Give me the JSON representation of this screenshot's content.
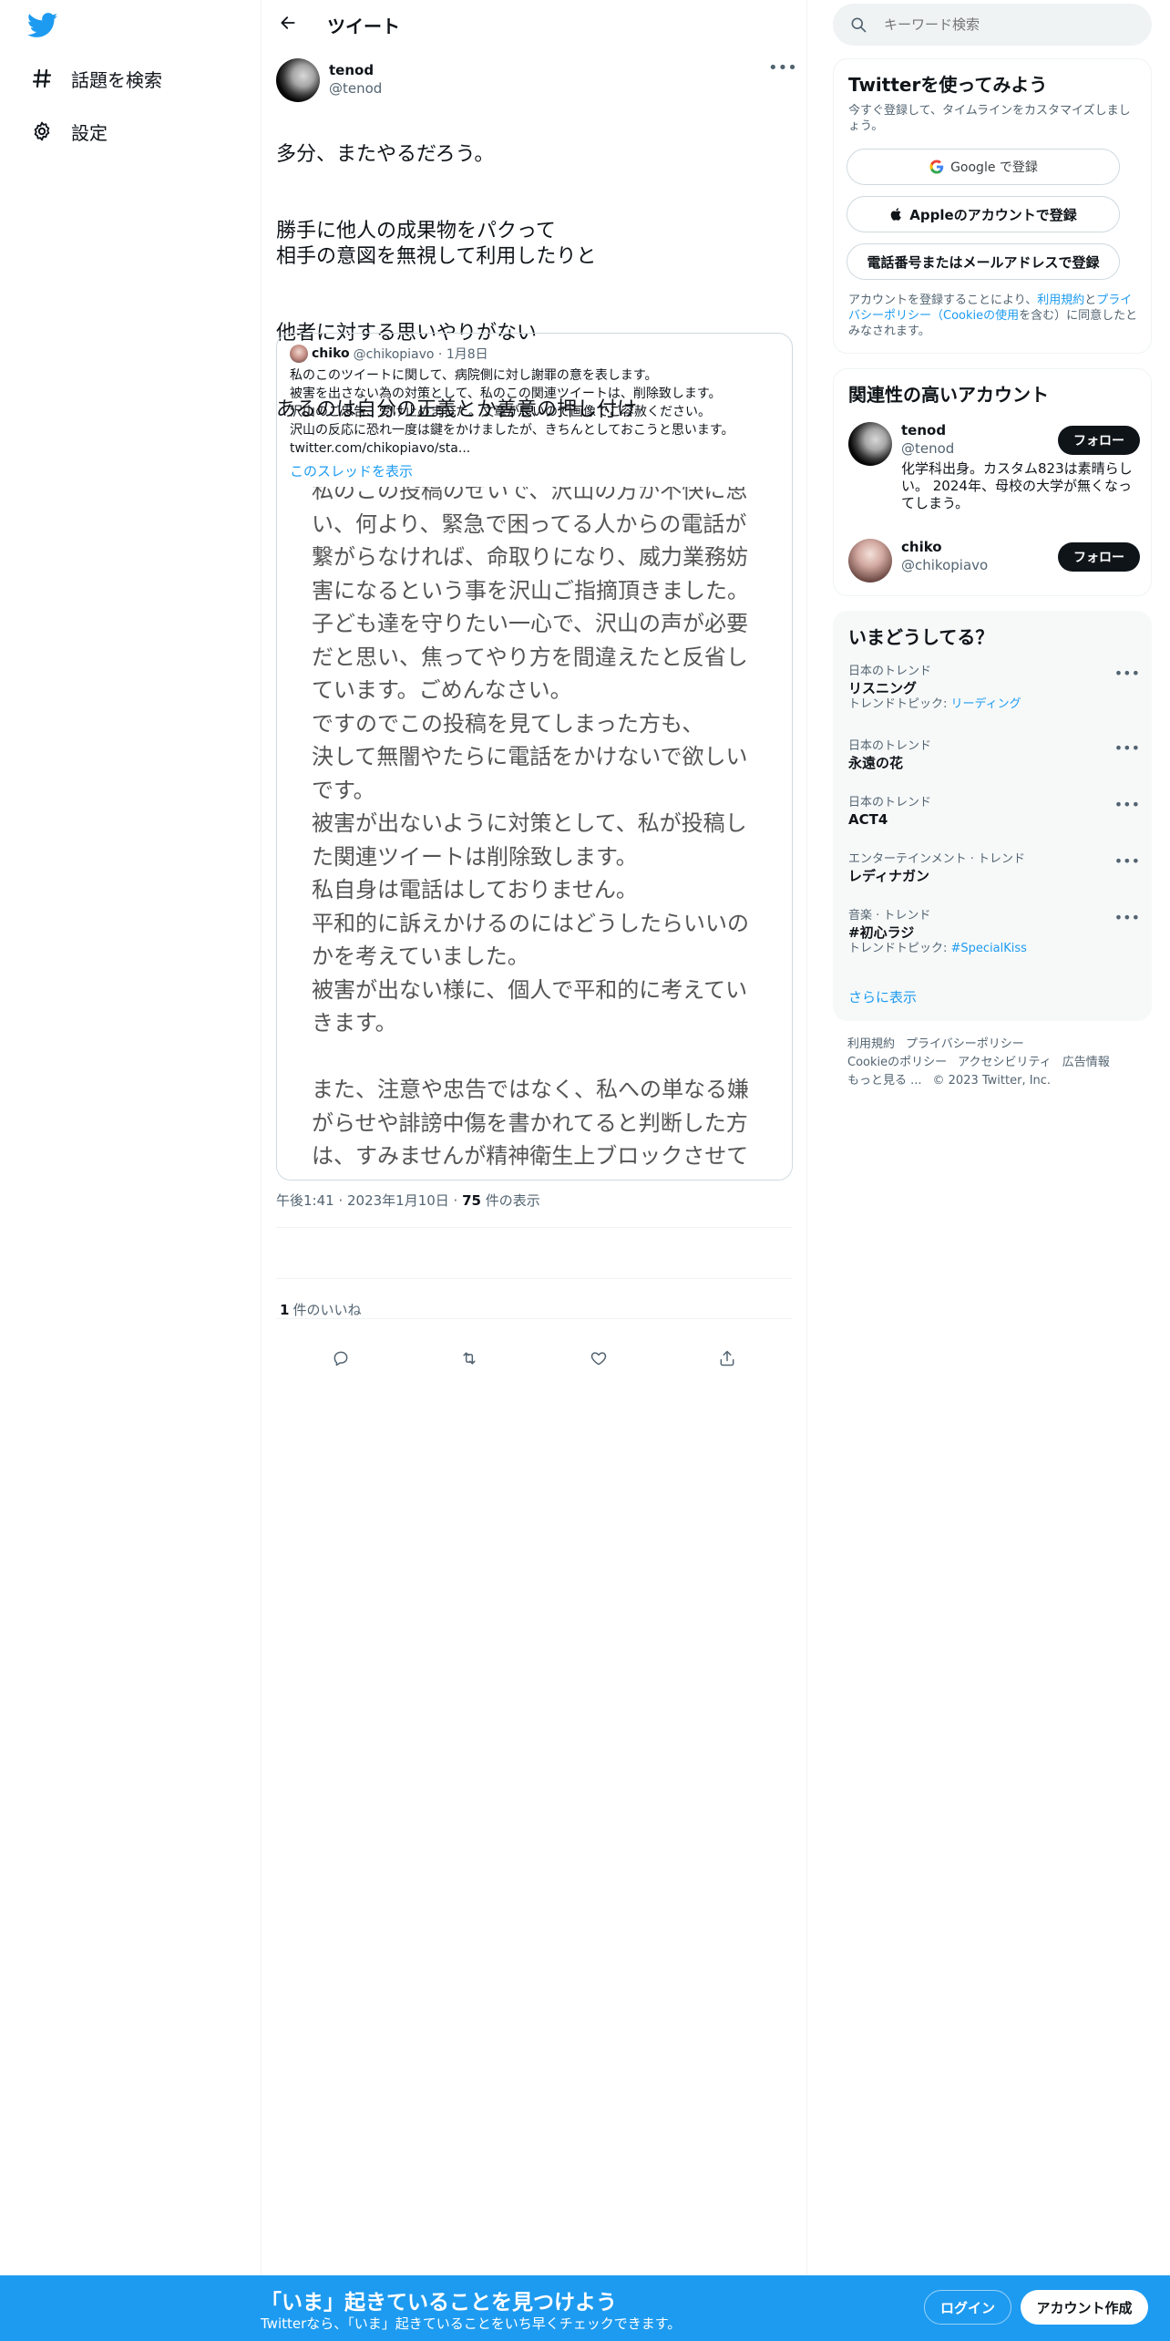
{
  "sidebar": {
    "items": [
      {
        "label": "話題を検索",
        "icon": "hashtag-icon"
      },
      {
        "label": "設定",
        "icon": "gear-icon"
      }
    ]
  },
  "header": {
    "title": "ツイート"
  },
  "tweet": {
    "author_name": "tenod",
    "author_handle": "@tenod",
    "paragraphs": [
      "多分、またやるだろう。",
      "勝手に他人の成果物をパクって\n相手の意図を無視して利用したりと",
      "他者に対する思いやりがない",
      "あるのは自分の正義とか善意の押し付け"
    ],
    "timestamp": "午後1:41 · 2023年1月10日 · ",
    "views_count": "75",
    "views_label": " 件の表示",
    "likes_count": "1",
    "likes_label": "件のいいね"
  },
  "quote": {
    "name": "chiko",
    "handle": "@chikopiavo · 1月8日",
    "body": "私のこのツイートに関して、病院側に対し謝罪の意を表します。\n被害を出さない為の対策として、私のこの関連ツイートは、削除致します。\n沢山のご忠告、受け止めました。文章が長いので画像でご容赦ください。\n沢山の反応に恐れ一度は鍵をかけましたが、きちんとしておこうと思います。\ntwitter.com/chikopiavo/sta...",
    "thread_link": "このスレッドを表示",
    "image_text": "私のこの投稿のせいで、沢山の方が不快に思い、何より、緊急で困ってる人からの電話が繋がらなければ、命取りになり、威力業務妨害になるという事を沢山ご指摘頂きました。\n子ども達を守りたい一心で、沢山の声が必要だと思い、焦ってやり方を間違えたと反省しています。ごめんなさい。\nですのでこの投稿を見てしまった方も、\n決して無闇やたらに電話をかけないで欲しいです。\n被害が出ないように対策として、私が投稿した関連ツイートは削除致します。\n私自身は電話はしておりません。\n平和的に訴えかけるのにはどうしたらいいのかを考えていました。\n被害が出ない様に、個人で平和的に考えていきます。\n\nまた、注意や忠告ではなく、私への単なる嫌がらせや誹謗中傷を書かれてると判断した方は、すみませんが精神衛生上ブロックさせて"
  },
  "search": {
    "placeholder": "キーワード検索"
  },
  "signup": {
    "title": "Twitterを使ってみよう",
    "subtitle": "今すぐ登録して、タイムラインをカスタマイズしましょう。",
    "google": "Google で登録",
    "apple": "Appleのアカウントで登録",
    "phone": "電話番号またはメールアドレスで登録",
    "terms_1": "アカウントを登録することにより、",
    "terms_link_1": "利用規約",
    "terms_2": "と",
    "terms_link_2": "プライバシーポリシー（Cookieの使用",
    "terms_3": "を含む）に同意したとみなされます。"
  },
  "related": {
    "title": "関連性の高いアカウント",
    "accounts": [
      {
        "name": "tenod",
        "handle": "@tenod",
        "bio": "化学科出身。カスタム823は素晴らしい。 2024年、母校の大学が無くなってしまう。",
        "follow": "フォロー"
      },
      {
        "name": "chiko",
        "handle": "@chikopiavo",
        "bio": "",
        "follow": "フォロー"
      }
    ]
  },
  "trends": {
    "title": "いまどうしてる？",
    "items": [
      {
        "context": "日本のトレンド",
        "name": "リスニング",
        "topic_label": "トレンドトピック: ",
        "topic": "リーディング"
      },
      {
        "context": "日本のトレンド",
        "name": "永遠の花",
        "topic_label": "",
        "topic": ""
      },
      {
        "context": "日本のトレンド",
        "name": "ACT4",
        "topic_label": "",
        "topic": ""
      },
      {
        "context": "エンターテインメント · トレンド",
        "name": "レディナガン",
        "topic_label": "",
        "topic": ""
      },
      {
        "context": "音楽 · トレンド",
        "name": "#初心ラジ",
        "topic_label": "トレンドトピック: ",
        "topic": "#SpecialKiss"
      }
    ],
    "show_more": "さらに表示"
  },
  "footer": {
    "links": [
      "利用規約",
      "プライバシーポリシー",
      "Cookieのポリシー",
      "アクセシビリティ",
      "広告情報",
      "もっと見る ..."
    ],
    "copyright": "© 2023 Twitter, Inc."
  },
  "banner": {
    "title": "「いま」起きていることを見つけよう",
    "subtitle": "Twitterなら、「いま」起きていることをいち早くチェックできます。",
    "login": "ログイン",
    "create": "アカウント作成"
  },
  "colors": {
    "accent": "#1d9bf0",
    "text": "#0f1419",
    "muted": "#536471"
  }
}
